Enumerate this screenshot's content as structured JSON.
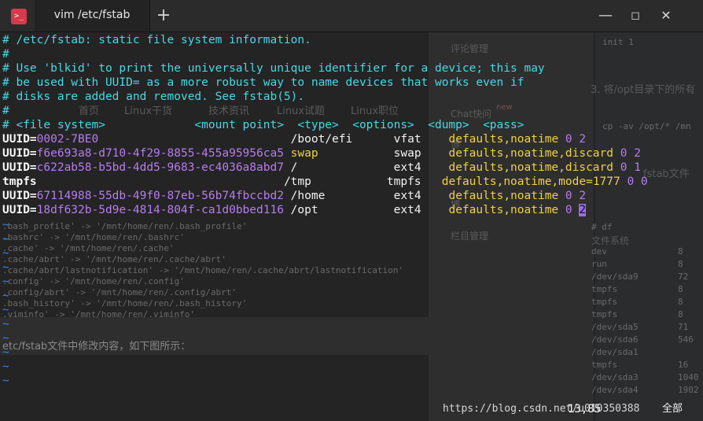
{
  "window": {
    "app_icon": ">_",
    "tab_title": "vim /etc/fstab",
    "new_tab_label": "+",
    "minimize": "—",
    "maximize": "◻",
    "close": "✕"
  },
  "editor": {
    "comment_lines": [
      "# /etc/fstab: static file system information.",
      "#",
      "# Use 'blkid' to print the universally unique identifier for a device; this may",
      "# be used with UUID= as a more robust way to name devices that works even if",
      "# disks are added and removed. See fstab(5).",
      "#",
      "# <file system>             <mount point>  <type>  <options>  <dump>  <pass>"
    ],
    "entries": [
      {
        "key": "UUID=",
        "value": "0002-7BE0",
        "pad": "                            ",
        "mount": "/boot/efi",
        "mpad": "      ",
        "type": "vfat",
        "tpad": "    ",
        "opt_prefix": "defaults,",
        "opt_keyword": "noatime",
        "opt_rest": " 0 2",
        "last": ""
      },
      {
        "key": "UUID=",
        "value": "f6e693a8-d710-4f29-8855-455a95956ca5",
        "pad": " ",
        "mount": "swap",
        "mpad": "           ",
        "type": "swap",
        "tpad": "    ",
        "opt_prefix": "defaults,",
        "opt_keyword": "noatime,discard",
        "opt_rest": " 0 2",
        "last": ""
      },
      {
        "key": "UUID=",
        "value": "c622ab58-b5bd-4dd5-9683-ec4036a8abd7",
        "pad": " ",
        "mount": "/",
        "mpad": "              ",
        "type": "ext4",
        "tpad": "    ",
        "opt_prefix": "defaults,",
        "opt_keyword": "noatime,discard",
        "opt_rest": " 0 1",
        "last": ""
      },
      {
        "key": "tmpfs",
        "value": "",
        "pad": "                                    ",
        "mount": "/tmp",
        "mpad": "           ",
        "type": "tmpfs",
        "tpad": "   ",
        "opt_prefix": "defaults,",
        "opt_keyword": "noatime,mode=1777",
        "opt_rest": " 0 0",
        "last": ""
      },
      {
        "key": "UUID=",
        "value": "67114988-55db-49f0-87eb-56b74fbccbd2",
        "pad": " ",
        "mount": "/home",
        "mpad": "          ",
        "type": "ext4",
        "tpad": "    ",
        "opt_prefix": "defaults,",
        "opt_keyword": "noatime",
        "opt_rest": " 0 2",
        "last": ""
      },
      {
        "key": "UUID=",
        "value": "18df632b-5d9e-4814-804f-ca1d0bbed116",
        "pad": " ",
        "mount": "/opt",
        "mpad": "           ",
        "type": "ext4",
        "tpad": "    ",
        "opt_prefix": "defaults,",
        "opt_keyword": "noatime",
        "opt_rest": " 0 ",
        "last": "2"
      }
    ],
    "tilde": "~",
    "cursor_position": "13,85",
    "scroll_position": "全部"
  },
  "background": {
    "ghost_left_text": [
      ".bash_profile' -> '/mnt/home/ren/.bash_profile'",
      ".bashrc' -> '/mnt/home/ren/.bashrc'",
      ".cache' -> '/mnt/home/ren/.cache'",
      ".cache/abrt' -> '/mnt/home/ren/.cache/abrt'",
      ".cache/abrt/lastnotification' -> '/mnt/home/ren/.cache/abrt/lastnotification'",
      ".config' -> '/mnt/home/ren/.config'",
      ".config/abrt' -> '/mnt/home/ren/.config/abrt'",
      ".bash_history' -> '/mnt/home/ren/.bash_history'",
      ".viminfo' -> '/mnt/home/ren/.viminfo'"
    ],
    "ghost_nav": [
      "首页",
      "Linux干货",
      "技术资讯",
      "Linux试题",
      "Linux职位"
    ],
    "ghost_caption": "etc/fstab文件中修改内容，如下图所示：",
    "ghost_menu": [
      "评论管理",
      "Chat快问",
      "new",
      "博",
      "博",
      "栏目管理"
    ],
    "ghost_code_1": "init 1",
    "ghost_step": "3. 将/opt目录下的所有",
    "ghost_code_2": "cp -av /opt/* /mn",
    "ghost_fstab": "fstab文件",
    "ghost_df_header": [
      "# df",
      "文件系统"
    ],
    "ghost_df_rows": [
      "dev",
      "run",
      "/dev/sda9",
      "tmpfs",
      "tmpfs",
      "tmpfs",
      "/dev/sda5",
      "/dev/sda6",
      "/dev/sda1",
      "tmpfs",
      "/dev/sda3",
      "/dev/sda4"
    ],
    "ghost_df_nums": [
      "8",
      "8",
      "72",
      "8",
      "8",
      "8",
      "71",
      "546",
      "",
      "16",
      "1040",
      "1902"
    ],
    "watermark": "https://blog.csdn.net/u010350388"
  }
}
